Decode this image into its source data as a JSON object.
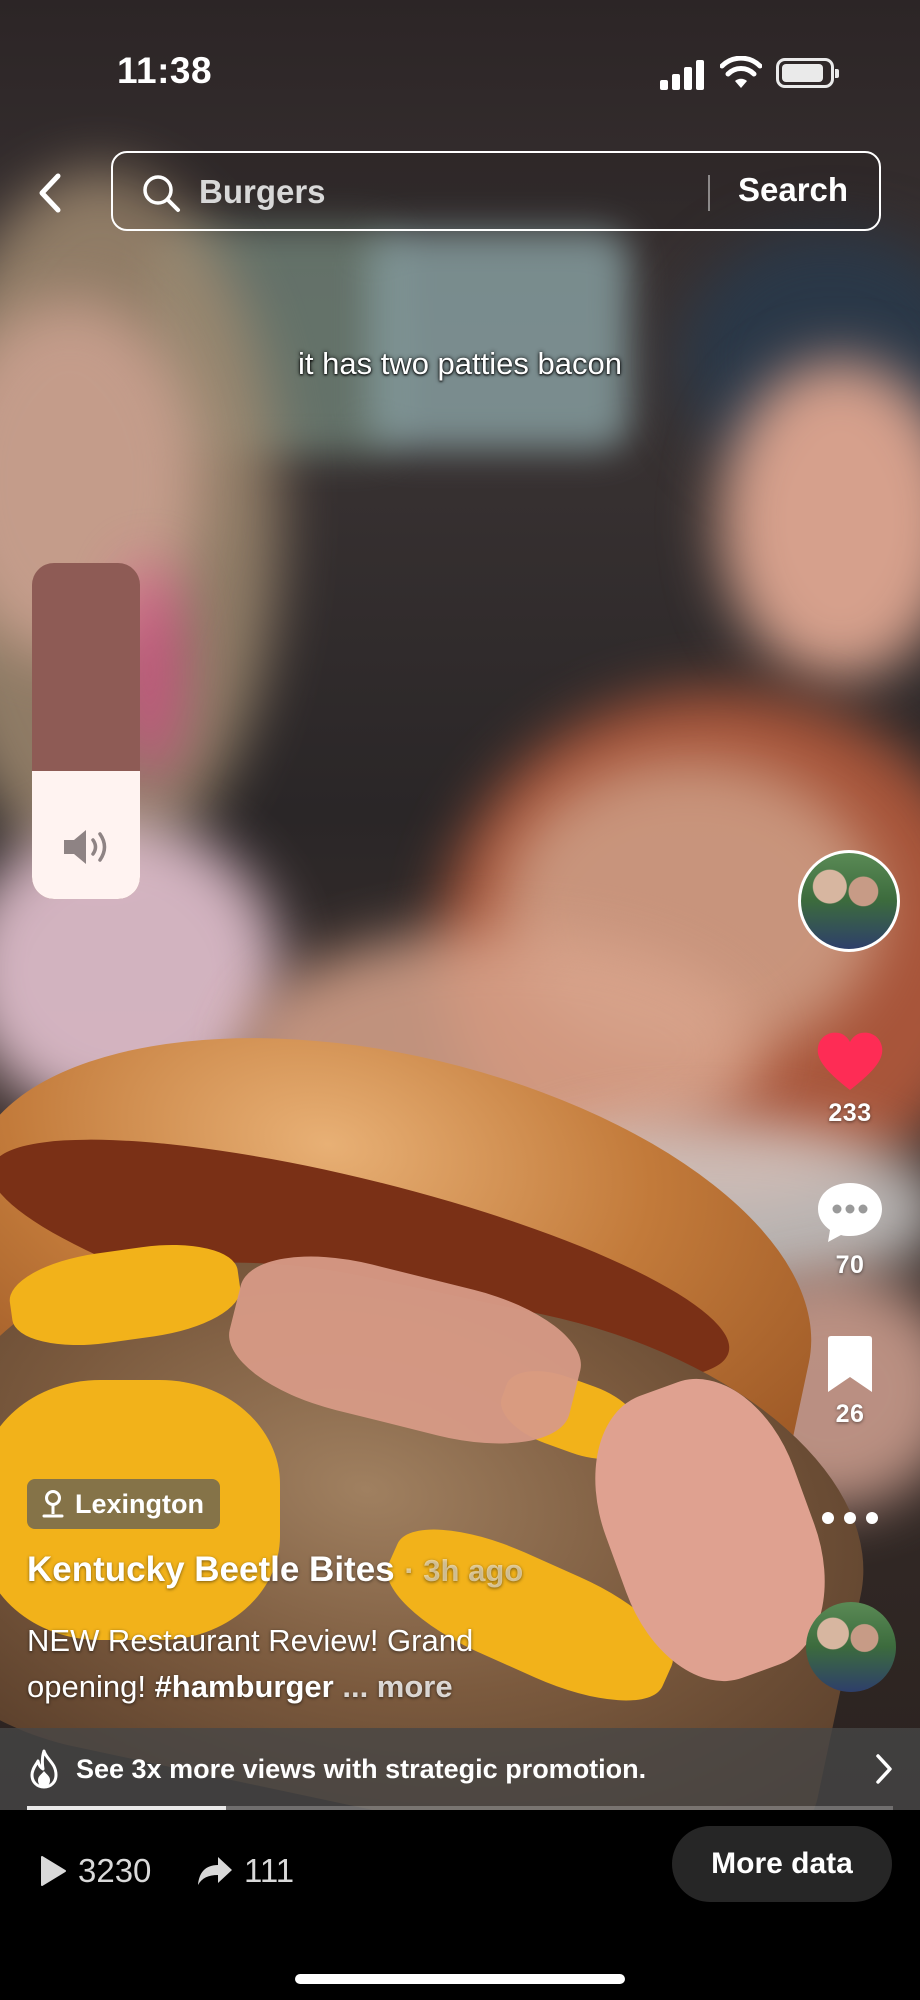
{
  "status_bar": {
    "time": "11:38"
  },
  "search": {
    "query": "Burgers",
    "button_label": "Search"
  },
  "video": {
    "caption": "it has two patties bacon"
  },
  "volume": {
    "level": 0.38
  },
  "actions": {
    "likes": "233",
    "comments": "70",
    "saves": "26"
  },
  "post": {
    "location": "Lexington",
    "author": "Kentucky Beetle Bites",
    "time_ago": "· 3h ago",
    "description_text": "NEW Restaurant Review! Grand opening! ",
    "hashtag": "#hamburger",
    "more_label": " ... more"
  },
  "promotion": {
    "text": "See 3x more views with strategic promotion."
  },
  "playback": {
    "progress": 0.23
  },
  "stats": {
    "plays": "3230",
    "shares": "111",
    "more_data_label": "More data"
  },
  "colors": {
    "like": "#fe2c55",
    "volume_track": "#8e5b55",
    "volume_fill": "#fff3f1"
  }
}
